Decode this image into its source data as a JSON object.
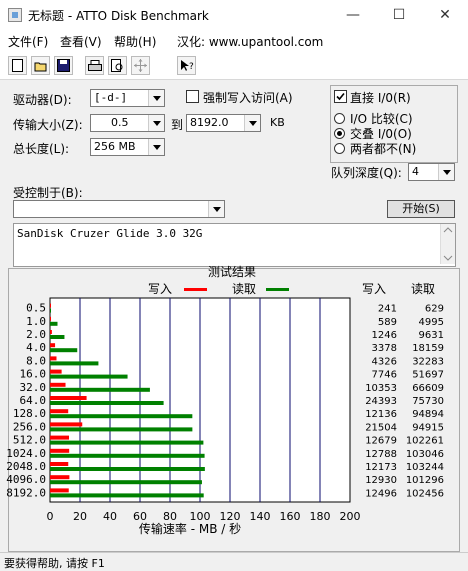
{
  "title_bar": {
    "title": "无标题 - ATTO Disk Benchmark"
  },
  "menu": [
    "文件(F)",
    "查看(V)",
    "帮助(H)",
    "汉化: www.upantool.com"
  ],
  "toolbar": {
    "icons": [
      "new-icon",
      "open-icon",
      "save-icon",
      "print-icon",
      "print-preview-icon",
      "move-icon",
      "help-icon"
    ]
  },
  "form": {
    "drive_label": "驱动器(D):",
    "drive_value": "[-d-]",
    "force_write_label": "强制写入访问(A)",
    "transfer_label": "传输大小(Z):",
    "transfer_from": "0.5",
    "transfer_to_label": "到",
    "transfer_to": "8192.0",
    "transfer_unit": "KB",
    "total_label": "总长度(L):",
    "total_value": "256 MB",
    "direct_io_label": "直接 I/0(R)",
    "io_compare_label": "I/O 比较(C)",
    "overlap_io_label": "交叠 I/0(O)",
    "neither_label": "两者都不(N)",
    "queue_label": "队列深度(Q):",
    "queue_value": "4",
    "controlled_label": "受控制于(B):",
    "controlled_value": "",
    "start_label": "开始(S)",
    "description": "SanDisk Cruzer Glide 3.0 32G"
  },
  "results": {
    "header": "测试结果",
    "write_legend": "写入",
    "read_legend": "读取",
    "col_write": "写入",
    "col_read": "读取",
    "xlabel": "传输速率 - MB / 秒"
  },
  "colors": {
    "write": "#ff0000",
    "read": "#008000"
  },
  "status": {
    "text": "要获得帮助, 请按 F1"
  },
  "chart_data": {
    "type": "bar",
    "orientation": "horizontal",
    "categories": [
      "0.5",
      "1.0",
      "2.0",
      "4.0",
      "8.0",
      "16.0",
      "32.0",
      "64.0",
      "128.0",
      "256.0",
      "512.0",
      "1024.0",
      "2048.0",
      "4096.0",
      "8192.0"
    ],
    "series": [
      {
        "name": "写入",
        "values": [
          0.24,
          0.59,
          1.25,
          3.38,
          4.33,
          7.75,
          10.35,
          24.39,
          12.14,
          21.5,
          12.68,
          12.79,
          12.17,
          12.93,
          12.5
        ]
      },
      {
        "name": "读取",
        "values": [
          0.63,
          5.0,
          9.63,
          18.16,
          32.28,
          51.7,
          66.61,
          75.73,
          94.89,
          94.92,
          102.26,
          103.05,
          103.24,
          101.3,
          102.46
        ]
      }
    ],
    "write_values_text": [
      "241",
      "589",
      "1246",
      "3378",
      "4326",
      "7746",
      "10353",
      "24393",
      "12136",
      "21504",
      "12679",
      "12788",
      "12173",
      "12930",
      "12496"
    ],
    "read_values_text": [
      "629",
      "4995",
      "9631",
      "18159",
      "32283",
      "51697",
      "66609",
      "75730",
      "94894",
      "94915",
      "102261",
      "103046",
      "103244",
      "101296",
      "102456"
    ],
    "xticks": [
      0,
      20,
      40,
      60,
      80,
      100,
      120,
      140,
      160,
      180,
      200
    ],
    "xlim": [
      0,
      200
    ],
    "xlabel": "传输速率 - MB / 秒",
    "grid": true,
    "legend": "top"
  }
}
